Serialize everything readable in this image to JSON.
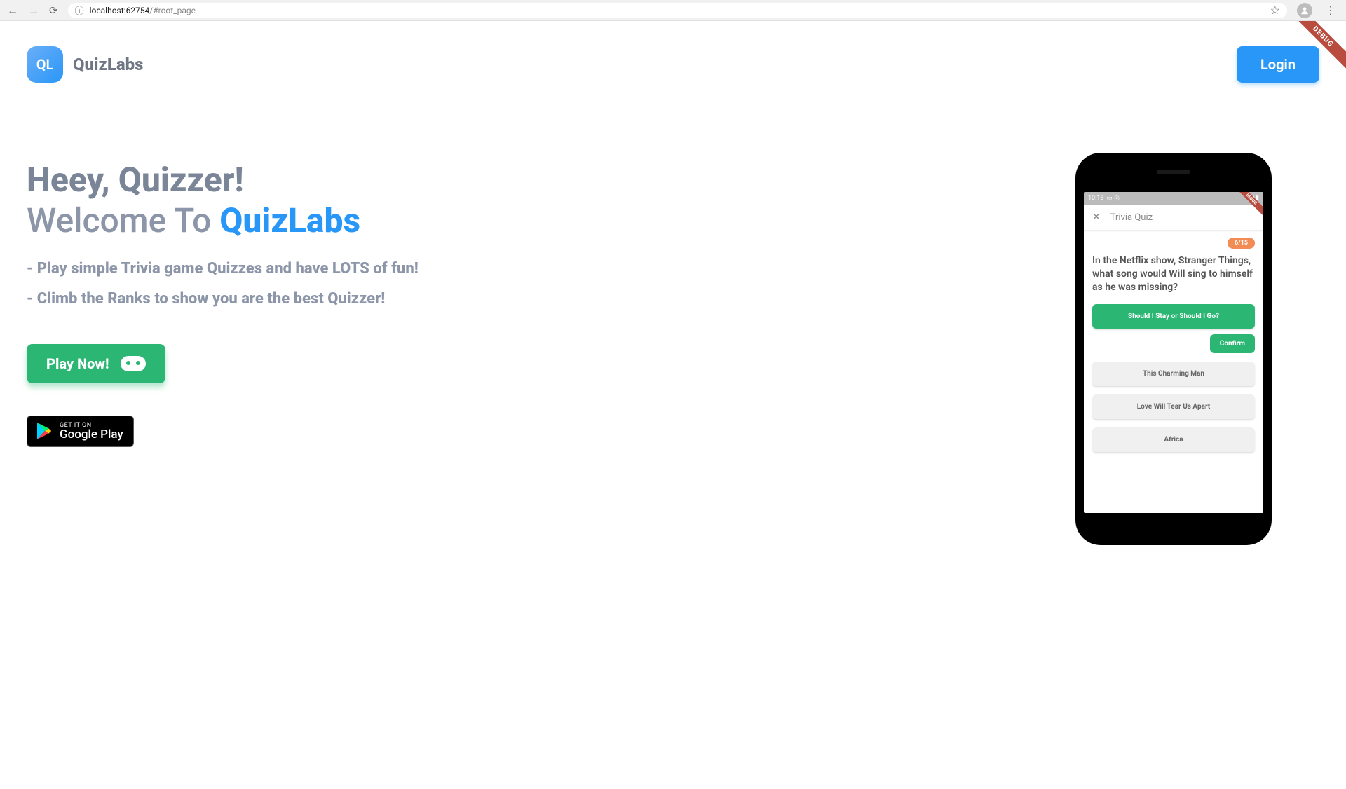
{
  "browser": {
    "url_host": "localhost",
    "url_port": ":62754",
    "url_path": "/#root_page"
  },
  "debug_ribbon_label": "DEBUG",
  "header": {
    "logo_text": "QL",
    "brand_name": "QuizLabs",
    "login_label": "Login"
  },
  "hero": {
    "heading": "Heey, Quizzer!",
    "subheading_prefix": "Welcome To ",
    "subheading_accent": "QuizLabs",
    "bullets": [
      "- Play simple Trivia game Quizzes and have LOTS of fun!",
      "- Climb the Ranks to show you are the best Quizzer!"
    ],
    "play_button": "Play Now!",
    "gplay_small": "GET IT ON",
    "gplay_large": "Google Play"
  },
  "phone": {
    "status_time": "10:13",
    "app_title": "Trivia Quiz",
    "counter": "6/15",
    "question": "In the Netflix show, Stranger Things, what song would Will sing to himself as he was missing?",
    "answers": [
      {
        "text": "Should I Stay or Should I Go?",
        "selected": true
      },
      {
        "text": "This Charming Man",
        "selected": false
      },
      {
        "text": "Love Will Tear Us Apart",
        "selected": false
      },
      {
        "text": "Africa",
        "selected": false
      }
    ],
    "confirm_label": "Confirm"
  }
}
